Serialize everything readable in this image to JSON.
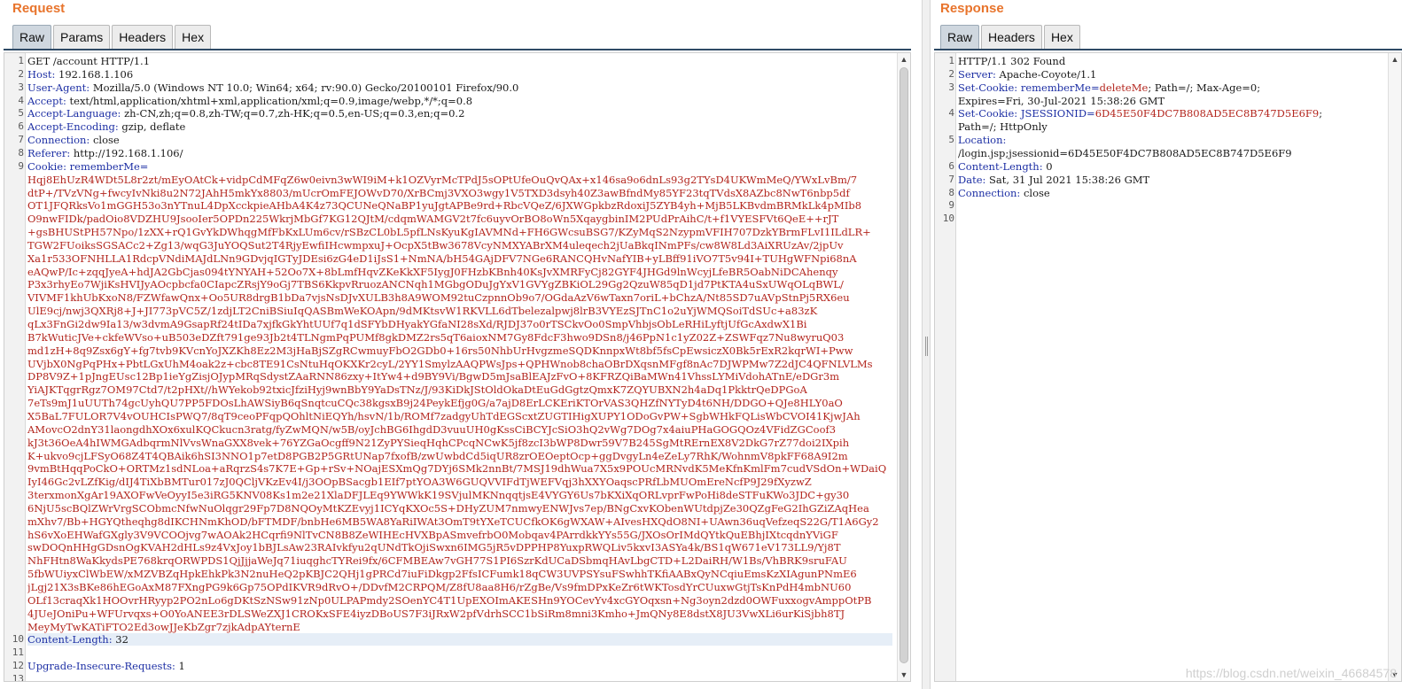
{
  "request": {
    "title": "Request",
    "tabs": [
      {
        "label": "Raw",
        "active": true
      },
      {
        "label": "Params",
        "active": false
      },
      {
        "label": "Headers",
        "active": false
      },
      {
        "label": "Hex",
        "active": false
      }
    ],
    "lines": [
      {
        "num": "1",
        "key": "",
        "value": "GET /account HTTP/1.1"
      },
      {
        "num": "2",
        "key": "Host:",
        "value": " 192.168.1.106"
      },
      {
        "num": "3",
        "key": "User-Agent:",
        "value": " Mozilla/5.0 (Windows NT 10.0; Win64; x64; rv:90.0) Gecko/20100101 Firefox/90.0"
      },
      {
        "num": "4",
        "key": "Accept:",
        "value": " text/html,application/xhtml+xml,application/xml;q=0.9,image/webp,*/*;q=0.8"
      },
      {
        "num": "5",
        "key": "Accept-Language:",
        "value": " zh-CN,zh;q=0.8,zh-TW;q=0.7,zh-HK;q=0.5,en-US;q=0.3,en;q=0.2"
      },
      {
        "num": "6",
        "key": "Accept-Encoding:",
        "value": " gzip, deflate"
      },
      {
        "num": "7",
        "key": "Connection:",
        "value": " close"
      },
      {
        "num": "8",
        "key": "Referer:",
        "value": " http://192.168.1.106/"
      },
      {
        "num": "9",
        "key": "Cookie:",
        "value": " rememberMe="
      }
    ],
    "cookie_value_lines": [
      "Hqj8EhUzR4WDt5L8r2zt/mEyOAtCk+vidpCdMFqZ6w0eivn3wWI9iM+k1OZVyrMcTPdJ5sOPtUfeOuQvQAx+x146sa9o6dnLs93g2TYsD4UKWmMeQ/YWxLvBm/7",
      "dtP+/TVzVNg+fwcyIvNki8u2N72JAhH5mkYx8803/mUcrOmFEJOWvD70/XrBCmj3VXO3wgy1V5TXD3dsyh40Z3awBfndMy85YF23tqTVdsX8AZbc8NwT6nbp5df",
      "OT1JFQRksVo1mGGH53o3nYTnuL4DpXcckpieAHbA4K4z73QCUNeQNaBP1yuJgtAPBe9rd+RbcVQeZ/6JXWGpkbzRdoxiJ5ZYB4yh+MjB5LKBvdmBRMkLk4pMIb8",
      "O9nwFIDk/padOio8VDZHU9JsooIer5OPDn225WkrjMbGf7KG12QJtM/cdqmWAMGV2t7fc6uyvOrBO8oWn5XqaygbinIM2PUdPrAihC/t+f1VYESFVt6QeE++rJT",
      "+gsBHUStPH57Npo/1zXX+rQ1GvYkDWhqgMfFbKxLUm6cv/rSBzCL0bL5pfLNsKyuKgIAVMNd+FH6GWcsuBSG7/KZyMqS2NzypmVFIH707DzkYBrmFLvI1ILdLR+",
      "TGW2FUoiksSGSACc2+Zg13/wqG3JuYOQSut2T4RjyEwfiIHcwmpxuJ+OcpX5tBw3678VcyNMXYABrXM4uleqech2jUaBkqINmPFs/cw8W8Ld3AiXRUzAv/2jpUv",
      "Xa1r533OFNHLLA1RdcpVNdiMAJdLNn9GDvjqIGTyJDEsi6zG4eD1iJsS1+NmNA/bH54GAjDFV7NGe6RANCQHvNafYIB+yLBff91iVO7T5v94I+TUHgWFNpi68nA",
      "eAQwP/Ic+zqqJyeA+hdJA2GbCjas094tYNYAH+52Oo7X+8bLmfHqvZKeKkXF5IygJ0FHzbKBnh40KsJvXMRFyCj82GYF4JHGd9lnWcyjLfeBR5OabNiDCAhenqy",
      "P3x3rhyEo7WjiKsHVIJyAOcpbcfa0CIapcZRsjY9oGj7TBS6KkpvRruozANCNqh1MGbgODuJgYxV1GVYgZBKiOL29Gg2QzuW85qD1jd7PtKTA4uSxUWqOLqBWL/",
      "VIVMF1khUbKxoN8/FZWfawQnx+Oo5UR8drgB1bDa7vjsNsDJvXULB3h8A9WOM92tuCzpnnOb9o7/OGdaAzV6wTaxn7oriL+bChzA/Nt85SD7uAVpStnPj5RX6eu",
      "UlE9cj/nwj3QXRj8+J+JI773pVC5Z/1zdjLT2CniBSiuIqQASBmWeKOApn/9dMKtsvW1RKVLL6dTbelezalpwj8lrB3VYEzSJTnC1o2uYjWMQSoiTdSUc+a83zK",
      "qLx3FnGi2dw9Ia13/w3dvmA9GsapRf24tIDa7xjfkGkYhtUUf7q1dSFYbDHyakYGfaNI28sXd/RJDJ37o0rTSCkvOo0SmpVhbjsObLeRHiLyftjUfGcAxdwX1Bi",
      "B7kWuticJVe+ckfeWVso+uB503eDZft791ge93Jb2t4TLNgmPqPUMf8gkDMZ2rs5qT6aioxNM7Gy8FdcF3hwo9DSn8/j46PpN1c1yZ02Z+ZSWFqz7Nu8wyruQ03",
      "md1zH+8q9Zsx6gY+fg7tvb9KVcnYoJXZKh8Ez2M3jHaBjSZgRCwmuyFbO2GDb0+16rs50NhbUrHvgzmeSQDKnnpxWt8bf5fsCpEwsiczX0Bk5rExR2kqrWI+Pww",
      "UVjbX0NgPqPHx+PbtLGxUhM4oak2z+cbc8TE91CsNtuHqOKXKr2cyL/2YY1SmylzAAQPWsJps+QPHWnob8chaOBrDXqsnMFgf8nAc7DJWPMw7Z2dJC4QFNLVLMs",
      "DP8V9Z+1pJngEUsc12Bp1ieYgZisjOJypMRqSdystZAaRNN86zxy+ItYw4+d9BY9Vi/BgwD5mJsaBlEAJzFvO+8KFRZQiBaMWn41VhssLYMiVdohATnE/eDGr3m",
      "YiAJKTqgrRgz7OM97Ctd7/t2pHXt//hWYekob92txicJfziHyj9wnBbY9YaDsTNz/J/93KiDkJStOldOkaDtEuGdGgtzQmxK7ZQYUBXN2h4aDq1PkktrQeDPGoA",
      "7eTs9mJ1uUUTh74gcUyhQU7PP5FDOsLhAWSiyB6qSnqtcuCQc38kgsxB9j24PeykEfjg0G/a7ajD8ErLCKEriKTOrVAS3QHZfNYTyD4t6NH/DDGO+QJe8HLY0aO",
      "X5BaL7FULOR7V4vOUHCIsPWQ7/8qT9ceoPFqpQOhltNiEQYh/hsvN/1b/ROMf7zadgyUhTdEGScxtZUGTIHigXUPY1ODoGvPW+SgbWHkFQLisWbCVOI41KjwJAh",
      "AMovcO2dnY31laongdhXOx6xulKQCkucn3ratg/fyZwMQN/w5B/oyJchBG6IhgdD3vuuUH0gKssCiBCYJcSiO3hQ2vWg7DOg7x4aiuPHaGOGQOz4VFidZGCoof3",
      "kJ3t36OeA4hIWMGAdbqrmNlVvsWnaGXX8vek+76YZGaOcgff9N21ZyPYSieqHqhCPcqNCwK5jf8zcI3bWP8Dwr59V7B245SgMtRErnEX8V2DkG7rZ77doi2IXpih",
      "K+ukvo9cjLFSyO68Z4T4QBAik6hSI3NNO1p7etD8PGB2P5GRtUNap7fxofB/zwUwbdCd5iqUR8zrOEOeptOcp+ggDvgyLn4eZeLy7RhK/WohnmV8pkFF68A9I2m",
      "9vmBtHqqPoCkO+ORTMz1sdNLoa+aRqrzS4s7K7E+Gp+rSv+NOajESXmQg7DYj6SMk2nnBt/7MSJ19dhWua7X5x9POUcMRNvdK5MeKfnKmlFm7cudVSdOn+WDaiQ",
      "IyI46Gc2vLZfKig/dIJ4TiXbBMTur017zJ0QCljVKzEv4I/j3OOpBSacgb1EIf7ptYOA3W6GUQVVIFdTjWEFVqj3hXXYOaqscPRfLbMUOmEreNcfP9J29fXyzwZ",
      "3terxmonXgAr19AXOFwVeOyyI5e3iRG5KNV08Ks1m2e21XlaDFJLEq9YWWkK19SVjulMKNnqqtjsE4VYGY6Us7bKXiXqORLvprFwPoHi8deSTFuKWo3JDC+gy30",
      "6NjU5scBQlZWrVrgSCObmcNfwNuOlqgr29Fp7D8NQOyMtKZEvyj1ICYqKXOc5S+DHyZUM7nmwyENWJvs7ep/BNgCxvKObenWUtdpjZe30QZgFeG2IhGZiZAqHea",
      "mXhv7/Bb+HGYQtheqhg8dIKCHNmKhOD/bFTMDF/bnbHe6MB5WA8YaRiIWAt3OmT9tYXeTCUCfkOK6gWXAW+AIvesHXQdO8NI+UAwn36uqVefzeqS22G/T1A6Gy2",
      "hS6vXoEHWafGXgly3V9VCOOjvg7wAOAk2HCqrfi9NlTvCN8B8ZeWIHEcHVXBpASmvefrbO0Mobqav4PArrdkkYYs55G/JXOsOrIMdQYtkQuEBhjIXtcqdnYViGF",
      "swDOQnHHgGDsnOgKVAH2dHLs9z4VxJoy1bBJLsAw23RAIvkfyu2qUNdTkOjiSwxn6IMG5jR5vDPPHP8YuxpRWQLiv5kxvI3ASYa4k/BS1qW671eV173LL9/Yj8T",
      "NhFHtn8WaKkydsPE768krqORWPDS1QjJjjaWeJq71iuqghcTYRei9fx/6CFMBEAw7vGH77S1PI6SzrKdUCaDSbmqHAvLbgCTD+L2DaiRH/W1Bs/VhBRK9sruFAU",
      "5fbWUiyxClWbEW/xMZVBZqHpkEhkPk3N2nuHeQ2pKBJC2QHj1gPRCd7iuFiDkgp2FfsICFumk18qCW3UVPSYsuFSwhhTKfiAABxQyNCqiuEmsKzXIAgunPNmE6",
      "jLgj21X3sBKe86hEGoAxM87FXngPG9k6Gp75OPdIKVR9dRvO+/DDvfM2CRPQM/Z8fU8aa8H6/rZgBe/Vs9fmDPxKeZr6tWKTosdYrCUuxwGtjTsKnPdH4mbNU60",
      "OLf13craqXk1HOOvrHRyyp2PO2nLo6gDKtSzNSw91zNp0ULPAPmdy2SOenYC4T1UpEXOImAKESHn9YOCevYv4xcGYOqxsn+Ng3oyn2dzd0OWFuxxogvAmppOtPB",
      "4JUeJOniPu+WFUrvqxs+O0YoANEE3rDLSWeZXJ1CROKxSFE4iyzDBoUS7F3iJRxW2pfVdrhSCC1bSiRm8mni3Kmho+JmQNy8E8dstX8JU3VwXLi6urKiSjbh8TJ",
      "MeyMyTwKATiFTO2Ed3owJJeKbZgr7zjkAdpAYternE"
    ],
    "tail_lines": [
      {
        "num": "10",
        "key": "Content-Length:",
        "value": " 32",
        "highlight": true
      },
      {
        "num": "11",
        "key": "",
        "value": ""
      },
      {
        "num": "12",
        "key": "Upgrade-Insecure-Requests:",
        "value": " 1"
      },
      {
        "num": "13",
        "key": "",
        "value": ""
      }
    ]
  },
  "response": {
    "title": "Response",
    "tabs": [
      {
        "label": "Raw",
        "active": true
      },
      {
        "label": "Headers",
        "active": false
      },
      {
        "label": "Hex",
        "active": false
      }
    ],
    "lines": [
      {
        "num": "1",
        "parts": [
          {
            "t": "HTTP/1.1 302 Found",
            "c": ""
          }
        ]
      },
      {
        "num": "2",
        "parts": [
          {
            "t": "Server:",
            "c": "key"
          },
          {
            "t": " Apache-Coyote/1.1",
            "c": ""
          }
        ]
      },
      {
        "num": "3",
        "parts": [
          {
            "t": "Set-Cookie:",
            "c": "key"
          },
          {
            "t": " rememberMe=",
            "c": "val-blue"
          },
          {
            "t": "deleteMe",
            "c": "val-red"
          },
          {
            "t": "; Path=/; Max-Age=0;",
            "c": ""
          }
        ]
      },
      {
        "num": "",
        "parts": [
          {
            "t": "Expires=Fri, 30-Jul-2021 15:38:26 GMT",
            "c": ""
          }
        ]
      },
      {
        "num": "4",
        "parts": [
          {
            "t": "Set-Cookie:",
            "c": "key"
          },
          {
            "t": " JSESSIONID=",
            "c": "val-blue"
          },
          {
            "t": "6D45E50F4DC7B808AD5EC8B747D5E6F9",
            "c": "val-red"
          },
          {
            "t": ";",
            "c": ""
          }
        ]
      },
      {
        "num": "",
        "parts": [
          {
            "t": "Path=/; HttpOnly",
            "c": ""
          }
        ]
      },
      {
        "num": "5",
        "parts": [
          {
            "t": "Location:",
            "c": "key"
          }
        ]
      },
      {
        "num": "",
        "parts": [
          {
            "t": "/login.jsp;jsessionid=6D45E50F4DC7B808AD5EC8B747D5E6F9",
            "c": ""
          }
        ]
      },
      {
        "num": "6",
        "parts": [
          {
            "t": "Content-Length:",
            "c": "key"
          },
          {
            "t": " 0",
            "c": ""
          }
        ]
      },
      {
        "num": "7",
        "parts": [
          {
            "t": "Date:",
            "c": "key"
          },
          {
            "t": " Sat, 31 Jul 2021 15:38:26 GMT",
            "c": ""
          }
        ]
      },
      {
        "num": "8",
        "parts": [
          {
            "t": "Connection:",
            "c": "key"
          },
          {
            "t": " close",
            "c": ""
          }
        ]
      },
      {
        "num": "9",
        "parts": []
      },
      {
        "num": "10",
        "parts": []
      }
    ]
  },
  "watermark": "https://blog.csdn.net/weixin_46684578"
}
